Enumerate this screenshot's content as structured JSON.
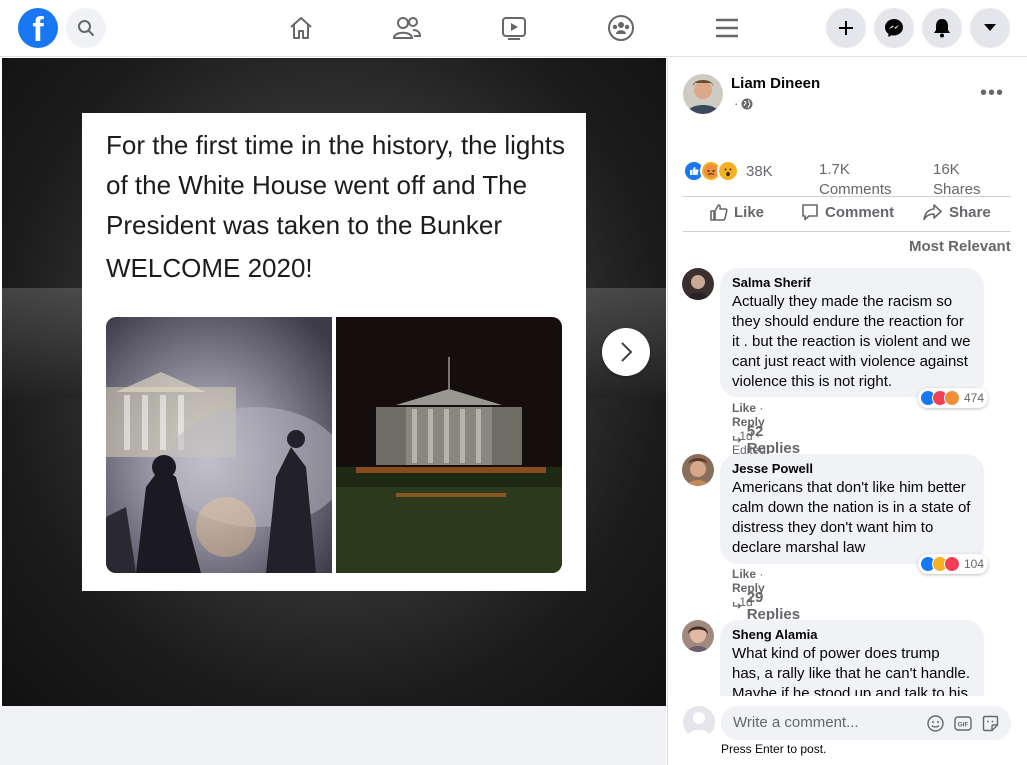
{
  "nav": {
    "logo": "f",
    "icons": [
      "home-icon",
      "friends-icon",
      "watch-icon",
      "groups-icon",
      "menu-icon"
    ],
    "right_buttons": [
      "create-icon",
      "messenger-icon",
      "notifications-icon",
      "account-dropdown-icon"
    ]
  },
  "post_image": {
    "headline": "For the first time in the history, the lights of the White House went off and The President was taken to the Bunker",
    "welcome": "WELCOME 2020!"
  },
  "author": {
    "name": "Liam Dineen",
    "meta": "·"
  },
  "stats": {
    "reactions_count": "38K",
    "comments": "1.7K Comments",
    "shares": "16K Shares"
  },
  "actions": {
    "like": "Like",
    "comment": "Comment",
    "share": "Share"
  },
  "sort_label": "Most Relevant",
  "comments": [
    {
      "name": "Salma Sherif",
      "text": "Actually they made the racism so they should endure the reaction for it . but the reaction is violent and we cant just react with violence against violence this is not right.",
      "like": "Like",
      "reply": "Reply",
      "meta": "· 1d · Edited",
      "reactions": "474",
      "replies": "52 Replies"
    },
    {
      "name": "Jesse Powell",
      "text": "Americans that don't like him better calm down the nation is in a state of distress they don't want him to declare marshal law",
      "like": "Like",
      "reply": "Reply",
      "meta": "· 1d",
      "reactions": "104",
      "replies": "29 Replies"
    },
    {
      "name": "Sheng Alamia",
      "text": "What kind of power does trump has, a rally like that he can't handle. Maybe if he stood up and talk to his"
    }
  ],
  "composer": {
    "placeholder": "Write a comment...",
    "hint": "Press Enter to post."
  },
  "colors": {
    "brand": "#1877f2",
    "like_blue": "#1877f2",
    "love_red": "#f33e58",
    "wow_yellow": "#f7b125"
  }
}
